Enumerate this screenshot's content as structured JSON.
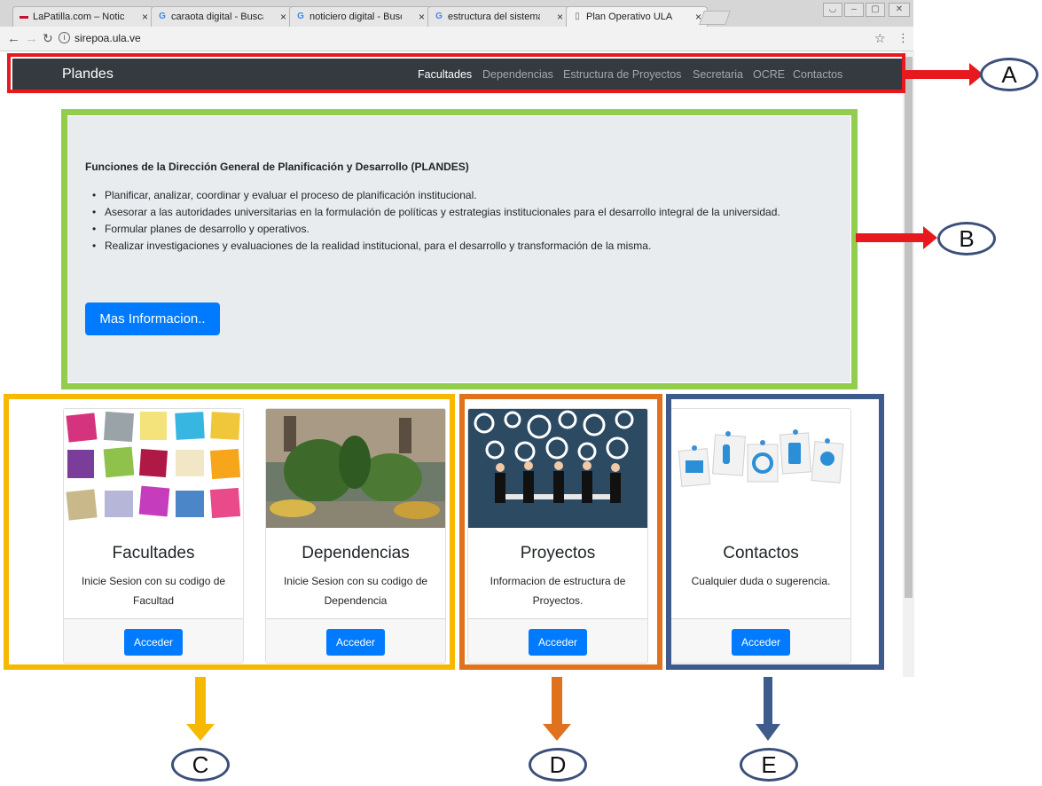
{
  "browser": {
    "tabs": [
      {
        "title": "LaPatilla.com – Noticias",
        "icon": "lapatilla-favicon"
      },
      {
        "title": "caraota digital - Buscar c",
        "icon": "google-favicon"
      },
      {
        "title": "noticiero digital - Buscar",
        "icon": "google-favicon"
      },
      {
        "title": "estructura del sistema - I",
        "icon": "google-favicon"
      },
      {
        "title": "Plan Operativo ULA",
        "icon": "page-icon"
      }
    ],
    "url": "sirepoa.ula.ve"
  },
  "navbar": {
    "brand": "Plandes",
    "links": [
      "Facultades",
      "Dependencias",
      "Estructura de Proyectos",
      "Secretaria",
      "OCRE",
      "Contactos"
    ],
    "active": "Facultades"
  },
  "jumbotron": {
    "title": "Funciones de la Dirección General de Planificación y Desarrollo (PLANDES)",
    "items": [
      "Planificar, analizar, coordinar y evaluar el proceso de planificación institucional.",
      "Asesorar a las autoridades universitarias en la formulación de políticas y estrategias institucionales para el desarrollo integral de la universidad.",
      "Formular planes de desarrollo y operativos.",
      "Realizar investigaciones y evaluaciones de la realidad institucional, para el desarrollo y transformación de la misma."
    ],
    "button": "Mas Informacion.."
  },
  "cards": [
    {
      "title": "Facultades",
      "text": "Inicie Sesion con su codigo de Facultad",
      "button": "Acceder",
      "image": "colorful-sticky-notes"
    },
    {
      "title": "Dependencias",
      "text": "Inicie Sesion con su codigo de Dependencia",
      "button": "Acceder",
      "image": "garden-courtyard-photo"
    },
    {
      "title": "Proyectos",
      "text": "Informacion de estructura de Proyectos.",
      "button": "Acceder",
      "image": "gears-meeting-illustration"
    },
    {
      "title": "Contactos",
      "text": "Cualquier duda o sugerencia.",
      "button": "Acceder",
      "image": "contact-icons-notes"
    }
  ],
  "callouts": [
    "A",
    "B",
    "C",
    "D",
    "E"
  ],
  "colors": {
    "navbar": "#343a40",
    "primary": "#007bff",
    "frame_a": "#e8191e",
    "frame_b": "#92cd4e",
    "frame_c": "#f7b800",
    "frame_d": "#e0711d",
    "frame_e": "#3e5b8c"
  }
}
